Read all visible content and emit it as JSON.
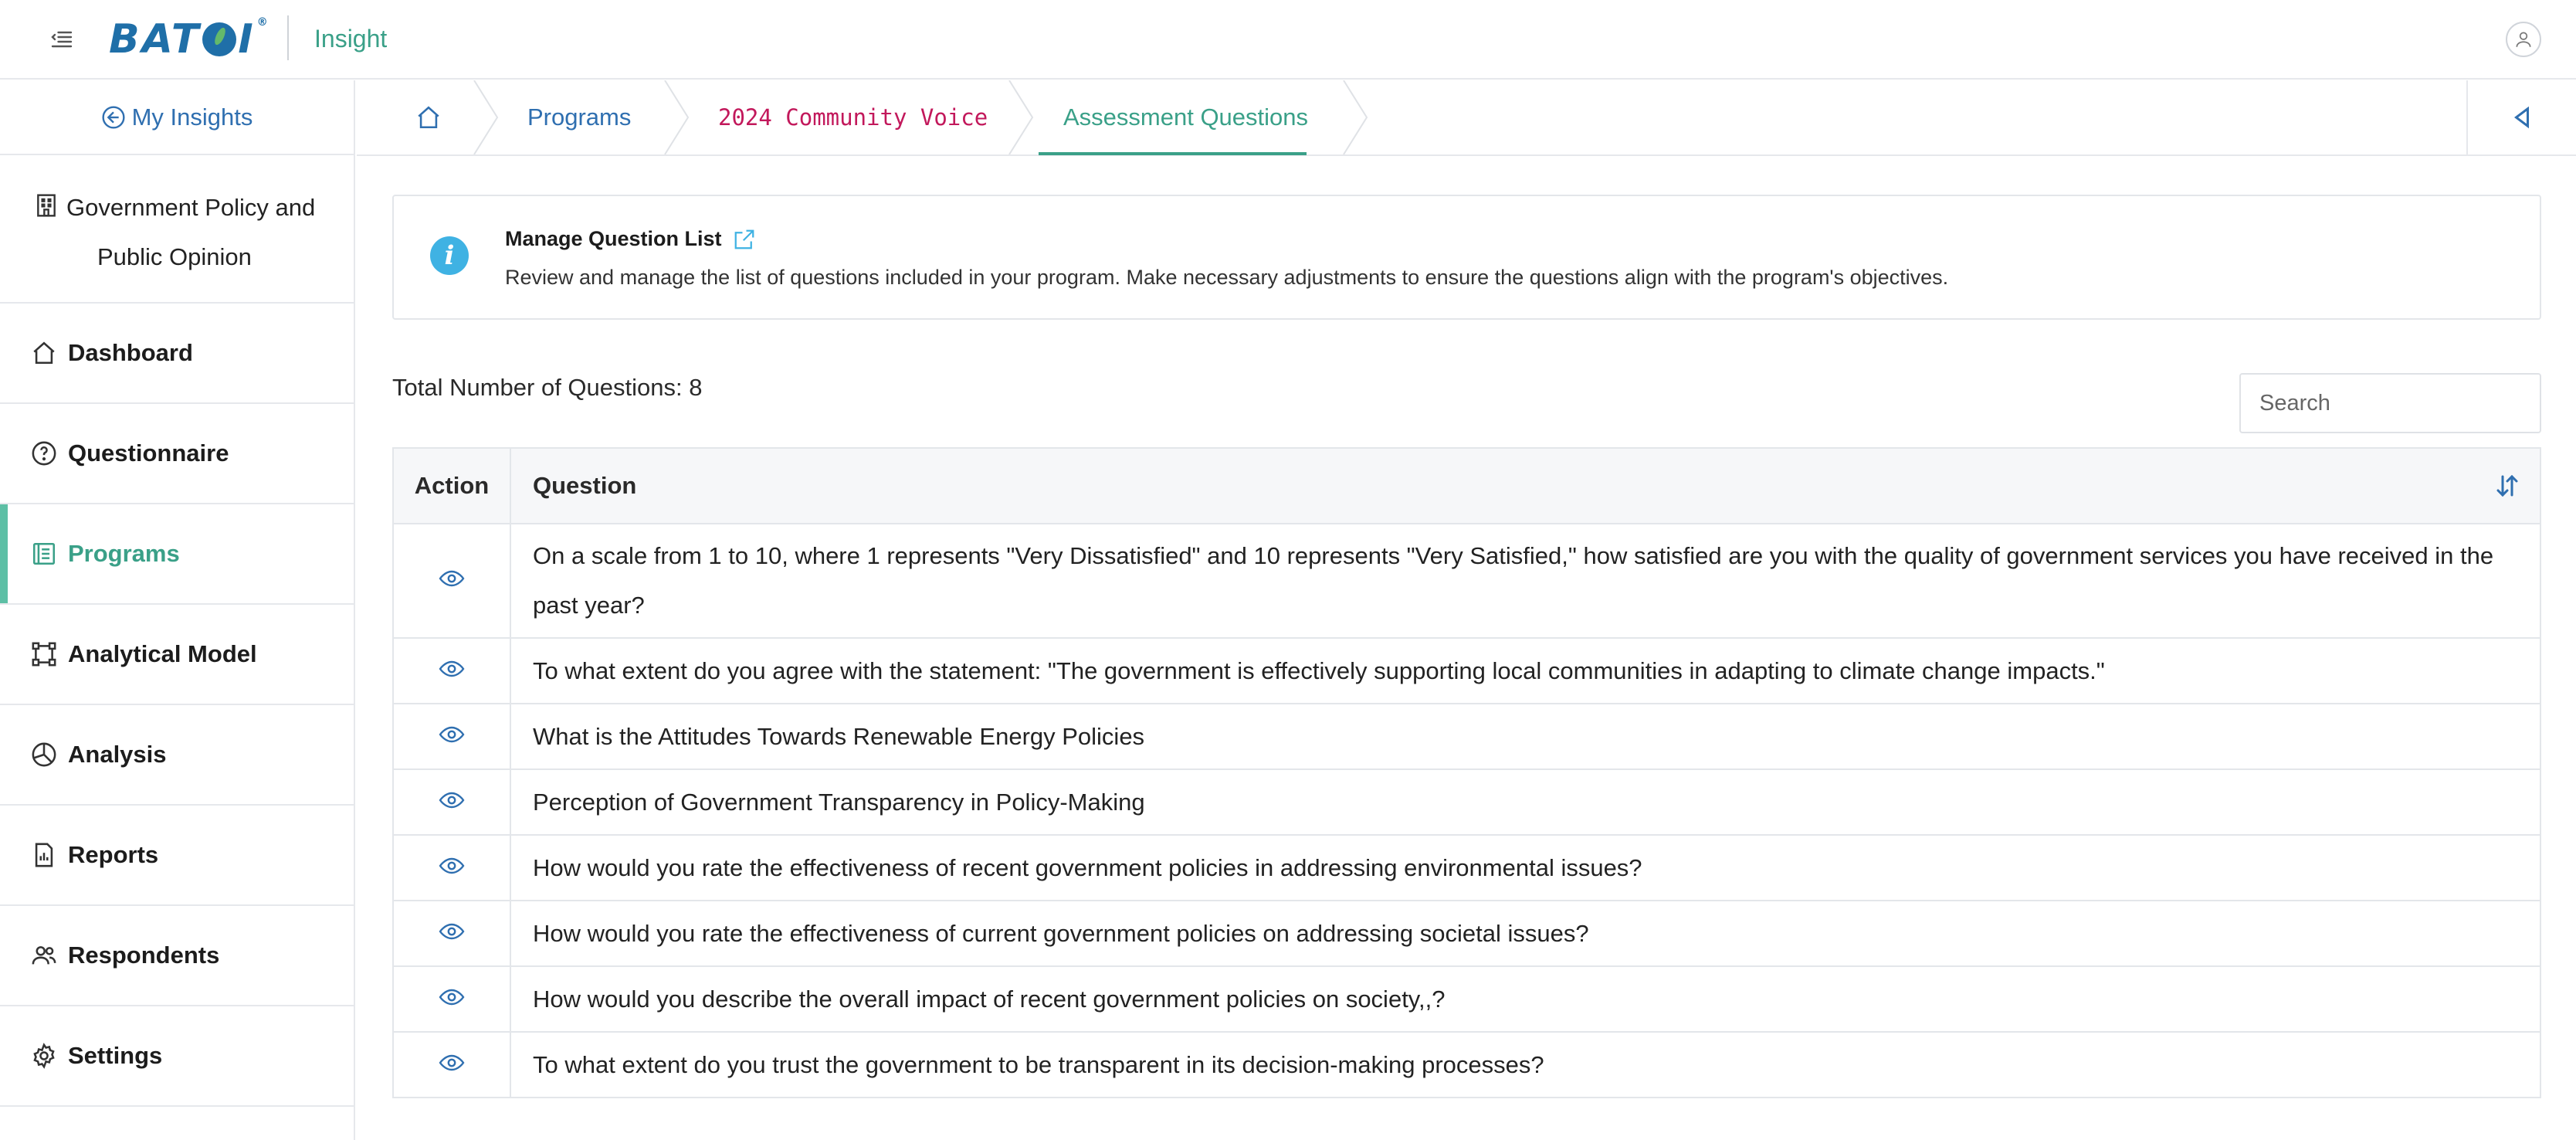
{
  "header": {
    "logo_text": "BATOI",
    "brand": "Insight"
  },
  "sidebar": {
    "back_link": "My Insights",
    "org_name_line1": "Government Policy and",
    "org_name_line2": "Public Opinion",
    "items": [
      {
        "label": "Dashboard",
        "icon": "home-icon",
        "active": false
      },
      {
        "label": "Questionnaire",
        "icon": "question-circle-icon",
        "active": false
      },
      {
        "label": "Programs",
        "icon": "document-list-icon",
        "active": true
      },
      {
        "label": "Analytical Model",
        "icon": "nodes-icon",
        "active": false
      },
      {
        "label": "Analysis",
        "icon": "pie-chart-icon",
        "active": false
      },
      {
        "label": "Reports",
        "icon": "report-icon",
        "active": false
      },
      {
        "label": "Respondents",
        "icon": "people-icon",
        "active": false
      },
      {
        "label": "Settings",
        "icon": "gear-icon",
        "active": false
      }
    ]
  },
  "breadcrumb": {
    "programs": "Programs",
    "program_name": "2024 Community Voice",
    "current": "Assessment Questions"
  },
  "info": {
    "title": "Manage Question List",
    "description": "Review and manage the list of questions included in your program. Make necessary adjustments to ensure the questions align with the program's objectives."
  },
  "list": {
    "total_label": "Total Number of Questions: 8",
    "search_placeholder": "Search"
  },
  "table": {
    "headers": {
      "action": "Action",
      "question": "Question"
    },
    "rows": [
      "On a scale from 1 to 10, where 1 represents \"Very Dissatisfied\" and 10 represents \"Very Satisfied,\" how satisfied are you with the quality of government services you have received in the past year?",
      "To what extent do you agree with the statement: \"The government is effectively supporting local communities in adapting to climate change impacts.\"",
      "What is the Attitudes Towards Renewable Energy Policies",
      "Perception of Government Transparency in Policy-Making",
      "How would you rate the effectiveness of recent government policies in addressing environmental issues?",
      "How would you rate the effectiveness of current government policies on addressing societal issues?",
      "How would you describe the overall impact of recent government policies on society,,?",
      "To what extent do you trust the government to be transparent in its decision-making processes?"
    ]
  },
  "colors": {
    "accent": "#3aa088",
    "link": "#2f6fb0",
    "program_name": "#c2185b",
    "info_icon": "#3fb2e3",
    "brand_blue": "#1f6fa8"
  }
}
